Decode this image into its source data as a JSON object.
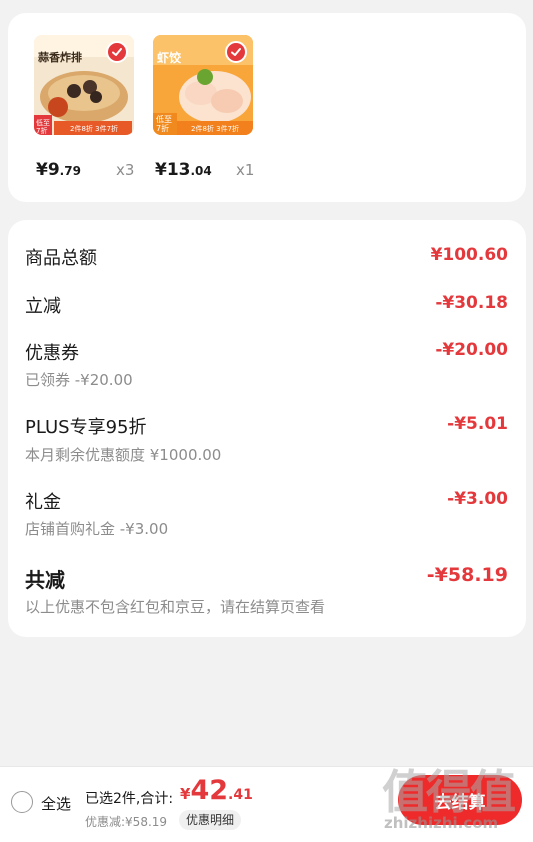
{
  "products": [
    {
      "price_int": "¥9",
      "price_dec": ".79",
      "qty": "x3",
      "img_title": "蒜香炸排",
      "img_badge": "低至7折",
      "img_footer": "2件8折 3件7折"
    },
    {
      "price_int": "¥13",
      "price_dec": ".04",
      "qty": "x1",
      "img_title": "虾饺",
      "img_badge": "低至7折",
      "img_footer": "2件8折 3件7折"
    }
  ],
  "summary": {
    "goods_total": {
      "label": "商品总额",
      "value": "¥100.60"
    },
    "instant_discount": {
      "label": "立减",
      "value": "-¥30.18"
    },
    "coupon": {
      "label": "优惠券",
      "value": "-¥20.00",
      "sub": "已领券 -¥20.00"
    },
    "plus": {
      "label": "PLUS专享95折",
      "value": "-¥5.01",
      "sub": "本月剩余优惠额度 ¥1000.00"
    },
    "gift": {
      "label": "礼金",
      "value": "-¥3.00",
      "sub": "店铺首购礼金 -¥3.00"
    },
    "total_discount": {
      "label": "共减",
      "value": "-¥58.19",
      "sub": "以上优惠不包含红包和京豆，请在结算页查看"
    }
  },
  "bottom_bar": {
    "select_all": "全选",
    "selected_info": "已选2件,合计:",
    "total_currency": "¥",
    "total_int": "42",
    "total_dec": ".41",
    "discount_line": "优惠减:¥58.19",
    "detail_button": "优惠明细",
    "checkout_button": "去结算"
  },
  "watermark": {
    "text": "值得值",
    "url": "zhizhizhi.com"
  },
  "colors": {
    "accent": "#e4393c",
    "background": "#f2f2f2"
  }
}
